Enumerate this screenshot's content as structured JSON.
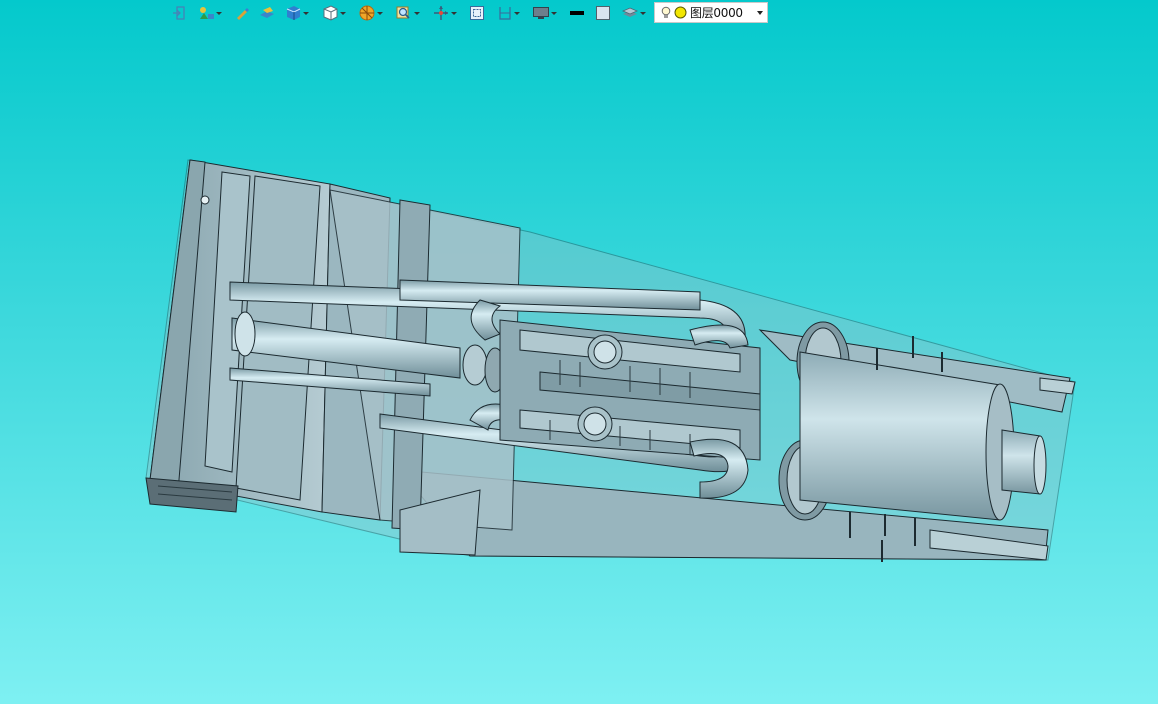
{
  "toolbar": {
    "buttons": [
      {
        "icon": "exit-icon",
        "dropdown": false
      },
      {
        "icon": "snap-icon",
        "dropdown": true
      },
      {
        "icon": "pen-icon",
        "dropdown": false
      },
      {
        "icon": "plane-icon",
        "dropdown": false
      },
      {
        "icon": "solid-box-icon",
        "dropdown": true
      },
      {
        "icon": "view-cube-icon",
        "dropdown": true
      },
      {
        "icon": "render-mode-icon",
        "dropdown": true
      },
      {
        "icon": "zoom-icon",
        "dropdown": true
      },
      {
        "icon": "move-axis-icon",
        "dropdown": true
      },
      {
        "icon": "fit-window-icon",
        "dropdown": false
      },
      {
        "icon": "section-icon",
        "dropdown": true
      },
      {
        "icon": "display-icon",
        "dropdown": true
      },
      {
        "icon": "line-color-icon",
        "dropdown": false
      },
      {
        "icon": "fill-color-icon",
        "dropdown": false
      },
      {
        "icon": "layers-icon",
        "dropdown": true
      }
    ],
    "layer_select": {
      "value": "图层0000"
    }
  },
  "colors": {
    "bg_top": "#04c9cc",
    "bg_bottom": "#7ef0f2",
    "model_fill": "#9fbfc8",
    "model_edge": "#1c2a30"
  }
}
